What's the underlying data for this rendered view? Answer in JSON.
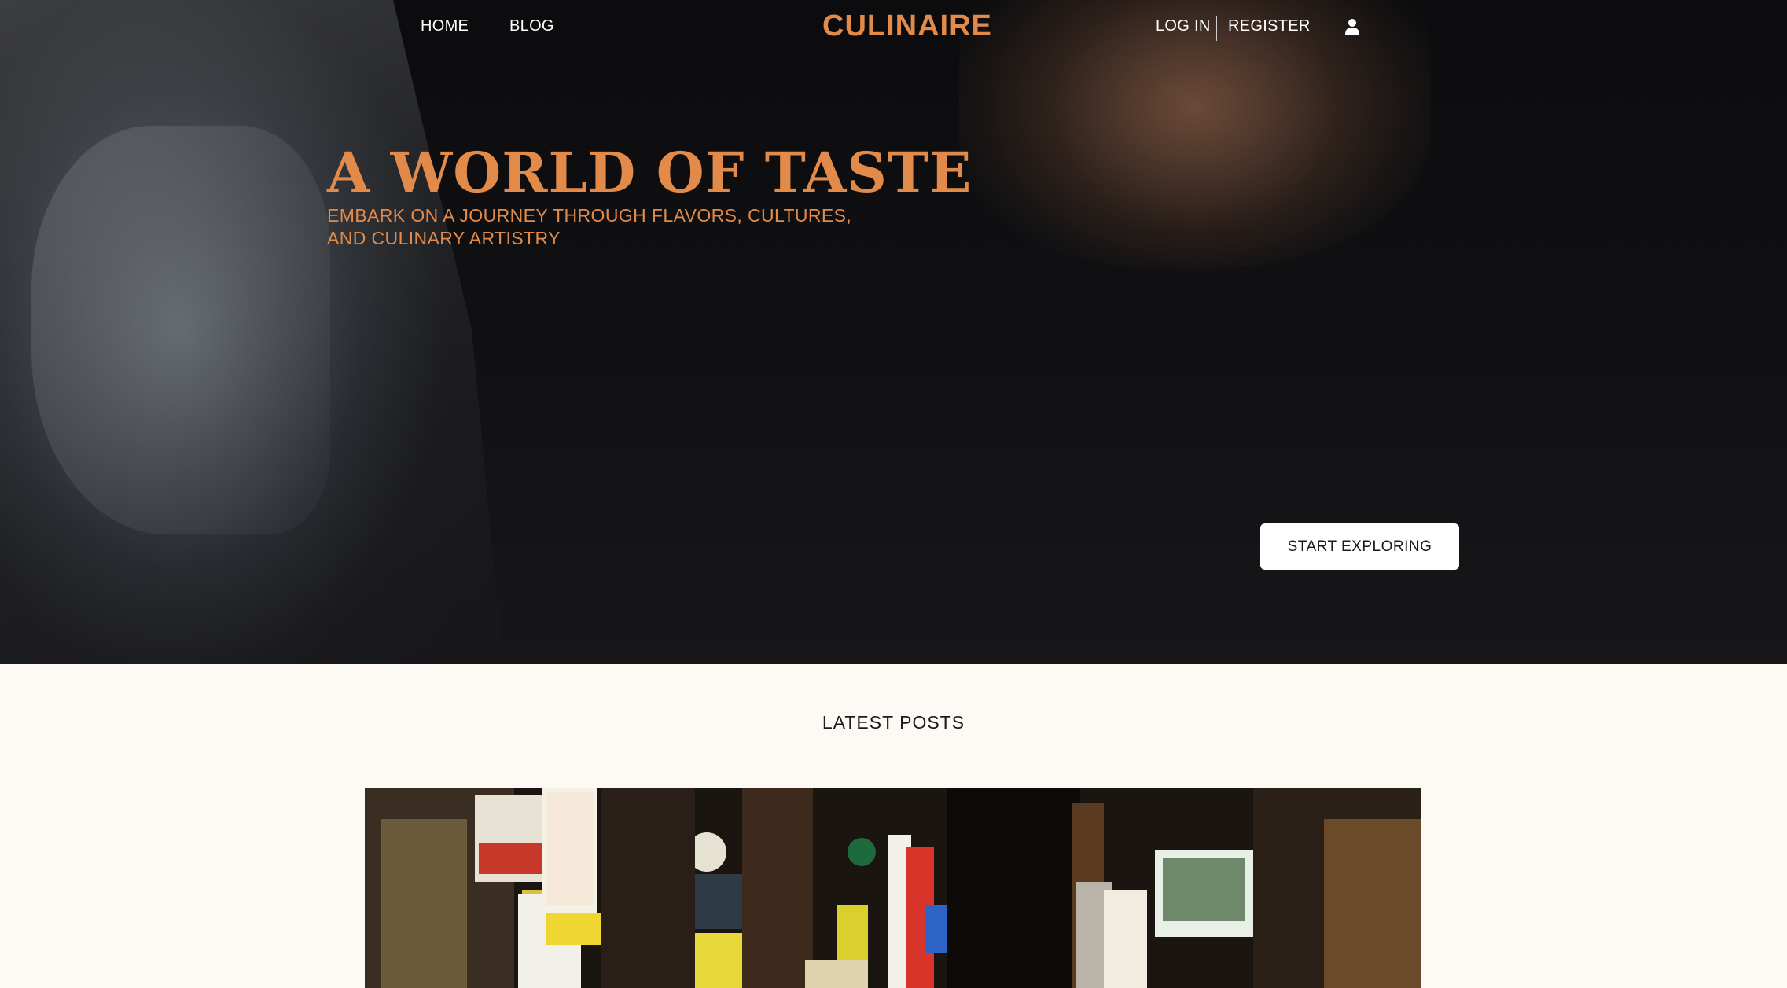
{
  "nav": {
    "links": [
      "HOME",
      "BLOG"
    ],
    "brand": "CULINAIRE",
    "login": "LOG IN",
    "register": "REGISTER",
    "user_icon": "user-icon"
  },
  "hero": {
    "title": "A WORLD OF TASTE",
    "subtitle": "EMBARK ON A JOURNEY THROUGH FLAVORS, CULTURES, AND CULINARY ARTISTRY",
    "cta_label": "START EXPLORING"
  },
  "latest": {
    "title": "LATEST POSTS"
  },
  "colors": {
    "accent": "#e28a4a",
    "page_bg": "#fdf9f5",
    "hero_bg": "#0c0c0e",
    "button_bg": "#ffffff"
  }
}
